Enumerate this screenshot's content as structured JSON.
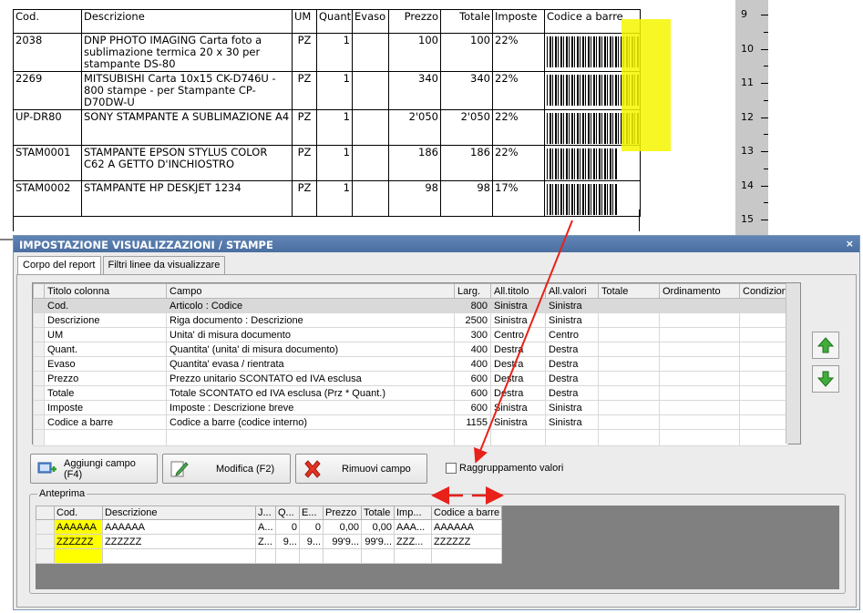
{
  "report": {
    "headers": {
      "cod": "Cod.",
      "descrizione": "Descrizione",
      "um": "UM",
      "quant": "Quant.",
      "evaso": "Evaso",
      "prezzo": "Prezzo",
      "totale": "Totale",
      "imposte": "Imposte",
      "codice_barre": "Codice a barre"
    },
    "rows": [
      {
        "cod": "2038",
        "descrizione": "DNP PHOTO IMAGING Carta foto a sublimazione termica 20 x 30 per stampante DS-80",
        "um": "PZ",
        "quant": "1",
        "evaso": "",
        "prezzo": "100",
        "totale": "100",
        "imposte": "22%"
      },
      {
        "cod": "2269",
        "descrizione": "MITSUBISHI Carta 10x15 CK-D746U - 800 stampe - per Stampante CP-D70DW-U",
        "um": "PZ",
        "quant": "1",
        "evaso": "",
        "prezzo": "340",
        "totale": "340",
        "imposte": "22%"
      },
      {
        "cod": "UP-DR80",
        "descrizione": "SONY STAMPANTE A SUBLIMAZIONE A4",
        "um": "PZ",
        "quant": "1",
        "evaso": "",
        "prezzo": "2'050",
        "totale": "2'050",
        "imposte": "22%"
      },
      {
        "cod": "STAM0001",
        "descrizione": "STAMPANTE EPSON STYLUS COLOR C62 A GETTO D'INCHIOSTRO",
        "um": "PZ",
        "quant": "1",
        "evaso": "",
        "prezzo": "186",
        "totale": "186",
        "imposte": "22%"
      },
      {
        "cod": "STAM0002",
        "descrizione": "STAMPANTE HP DESKJET 1234",
        "um": "PZ",
        "quant": "1",
        "evaso": "",
        "prezzo": "98",
        "totale": "98",
        "imposte": "17%"
      }
    ]
  },
  "ruler": {
    "numbers": [
      "9",
      "10",
      "11",
      "12",
      "13",
      "14",
      "15"
    ]
  },
  "dialog": {
    "title": "IMPOSTAZIONE VISUALIZZAZIONI / STAMPE",
    "close": "×",
    "tabs": [
      "Corpo del report",
      "Filtri linee da visualizzare"
    ],
    "grid": {
      "headers": {
        "titolo": "Titolo colonna",
        "campo": "Campo",
        "larg": "Larg.",
        "all_titolo": "All.titolo",
        "all_valori": "All.valori",
        "totale": "Totale",
        "ordinamento": "Ordinamento",
        "condizioni": "Condizioni"
      },
      "rows": [
        {
          "titolo": "Cod.",
          "campo": "Articolo : Codice",
          "larg": "800",
          "all_titolo": "Sinistra",
          "all_valori": "Sinistra"
        },
        {
          "titolo": "Descrizione",
          "campo": "Riga documento : Descrizione",
          "larg": "2500",
          "all_titolo": "Sinistra",
          "all_valori": "Sinistra"
        },
        {
          "titolo": "UM",
          "campo": "Unita' di misura documento",
          "larg": "300",
          "all_titolo": "Centro",
          "all_valori": "Centro"
        },
        {
          "titolo": "Quant.",
          "campo": "Quantita' (unita' di misura documento)",
          "larg": "400",
          "all_titolo": "Destra",
          "all_valori": "Destra"
        },
        {
          "titolo": "Evaso",
          "campo": "Quantita' evasa / rientrata",
          "larg": "400",
          "all_titolo": "Destra",
          "all_valori": "Destra"
        },
        {
          "titolo": "Prezzo",
          "campo": "Prezzo unitario SCONTATO ed IVA esclusa",
          "larg": "600",
          "all_titolo": "Destra",
          "all_valori": "Destra"
        },
        {
          "titolo": "Totale",
          "campo": "Totale SCONTATO ed IVA esclusa (Prz * Quant.)",
          "larg": "600",
          "all_titolo": "Destra",
          "all_valori": "Destra"
        },
        {
          "titolo": "Imposte",
          "campo": "Imposte : Descrizione breve",
          "larg": "600",
          "all_titolo": "Sinistra",
          "all_valori": "Sinistra"
        },
        {
          "titolo": "Codice a barre",
          "campo": "Codice a barre (codice interno)",
          "larg": "1155",
          "all_titolo": "Sinistra",
          "all_valori": "Sinistra"
        }
      ]
    },
    "buttons": {
      "aggiungi": "Aggiungi campo (F4)",
      "modifica": "Modifica (F2)",
      "rimuovi": "Rimuovi campo"
    },
    "checkbox": {
      "label": "Raggruppamento valori"
    },
    "anteprima": {
      "label": "Anteprima",
      "headers": [
        "Cod.",
        "Descrizione",
        "J...",
        "Q...",
        "E...",
        "Prezzo",
        "Totale",
        "Imp...",
        "Codice a barre"
      ],
      "rows": [
        [
          "AAAAAA",
          "AAAAAA",
          "A...",
          "0",
          "0",
          "0,00",
          "0,00",
          "AAA...",
          "AAAAAA"
        ],
        [
          "ZZZZZZ",
          "ZZZZZZ",
          "Z...",
          "9...",
          "9...",
          "99'9...",
          "99'9...",
          "ZZZ...",
          "ZZZZZZ"
        ]
      ]
    }
  },
  "colors": {
    "highlight": "#ffff00",
    "annotation_arrow": "#e8211a",
    "titlebar": "#5f84b5"
  }
}
